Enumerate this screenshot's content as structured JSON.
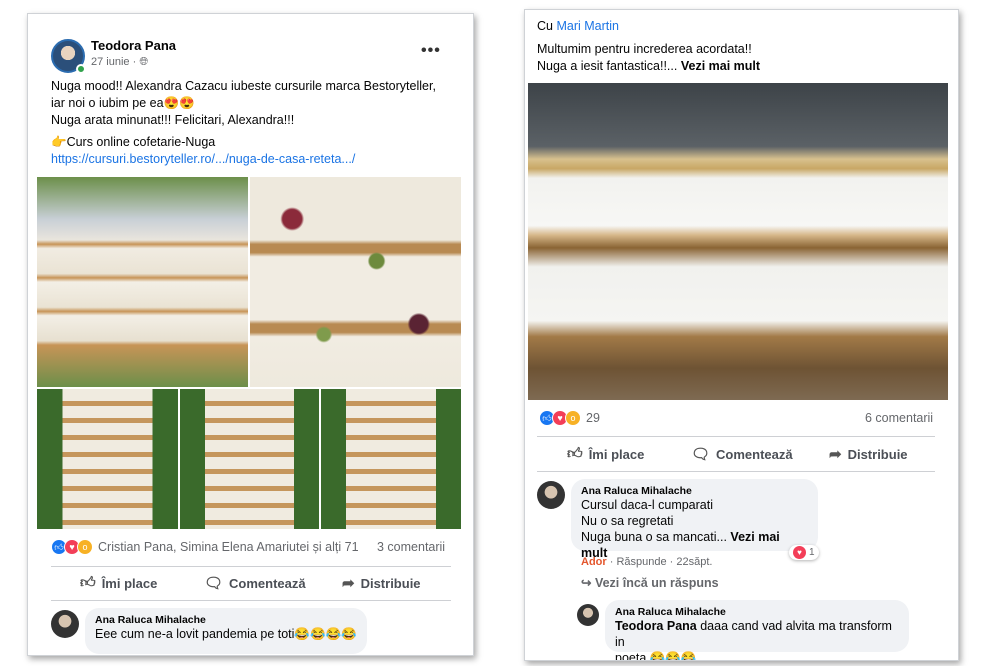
{
  "left_post": {
    "author": "Teodora Pana",
    "date": "27 iunie · ",
    "globe_icon": "globe-icon",
    "text_line1": "Nuga mood!! Alexandra Cazacu iubeste cursurile marca Bestoryteller,",
    "text_line2": "iar noi o iubim pe ea😍😍",
    "text_line3": "Nuga arata minunat!!! Felicitari, Alexandra!!!",
    "text_line4": "👉Curs online cofetarie-Nuga",
    "link": "https://cursuri.bestoryteller.ro/.../nuga-de-casa-reteta.../",
    "reactions_text": "Cristian Pana, Simina Elena Amariutei și alți 71",
    "comments_count": "3 comentarii",
    "actions": {
      "like": "Îmi place",
      "comment": "Comentează",
      "share": "Distribuie"
    },
    "comment": {
      "name": "Ana Raluca Mihalache",
      "text": "Eee cum ne-a lovit pandemia pe toti😂😂😂😂"
    }
  },
  "right_post": {
    "with_prefix": "Cu ",
    "with_name": "Mari Martin",
    "text_line1": "Multumim pentru increderea acordata!!",
    "text_line2": "Nuga a iesit fantastica!!...",
    "see_more": "Vezi mai mult",
    "reactions_count": "29",
    "comments_count": "6 comentarii",
    "actions": {
      "like": "Îmi place",
      "comment": "Comentează",
      "share": "Distribuie"
    },
    "comment1": {
      "name": "Ana Raluca Mihalache",
      "line1": "Cursul daca-l cumparati",
      "line2": "Nu o sa regretati",
      "line3": "Nuga buna o sa mancati...",
      "see_more": "Vezi mai mult",
      "love_count": "1",
      "meta_ador": "Ador",
      "meta_rest": " · Răspunde · 22săpt."
    },
    "replies_link": "↪ Vezi încă un răspuns",
    "comment2": {
      "name": "Ana Raluca Mihalache",
      "mention": "Teodora Pana",
      "text_a": " daaa cand vad alvita ma transform in",
      "text_b": "poeta 😂😂😂"
    }
  }
}
